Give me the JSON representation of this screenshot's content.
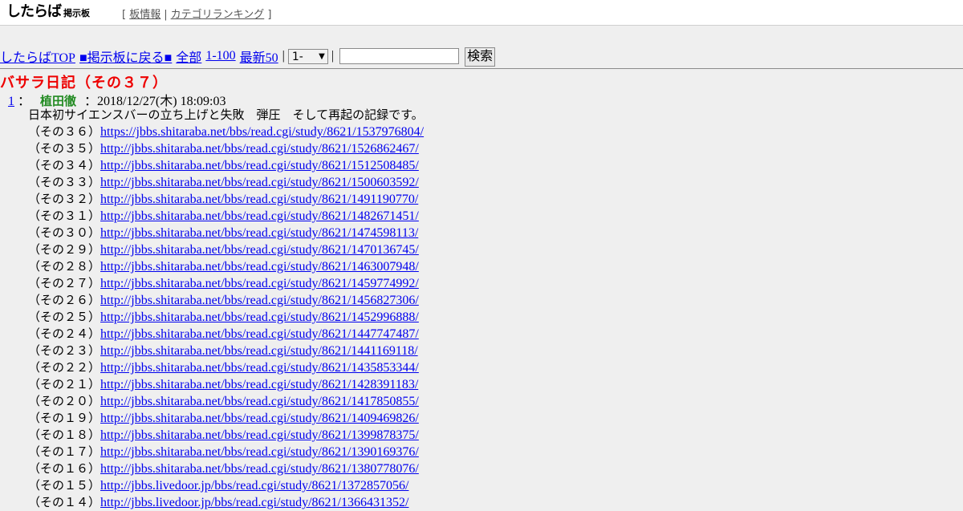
{
  "header": {
    "logo_main": "したらば",
    "logo_sub": "掲示板",
    "bracket_open": "[",
    "bracket_close": "]",
    "links": [
      "板情報",
      "カテゴリランキング"
    ]
  },
  "nav": {
    "links": [
      "したらばTOP",
      "■掲示板に戻る■",
      "全部",
      "1-100",
      "最新50"
    ],
    "separator": "|",
    "range_select": "1-",
    "search_button": "検索",
    "search_value": ""
  },
  "thread": {
    "title": "バサラ日記（その３７）",
    "post": {
      "number": "1",
      "colon": "：",
      "name": "植田徹",
      "date": "：2018/12/27(木) 18:09:03",
      "intro": "日本初サイエンスバーの立ち上げと失敗　弾圧　そして再起の記録です。",
      "entries": [
        {
          "label": "（その３６）",
          "url": "https://jbbs.shitaraba.net/bbs/read.cgi/study/8621/1537976804/"
        },
        {
          "label": "（その３５）",
          "url": "http://jbbs.shitaraba.net/bbs/read.cgi/study/8621/1526862467/"
        },
        {
          "label": "（その３４）",
          "url": "http://jbbs.shitaraba.net/bbs/read.cgi/study/8621/1512508485/"
        },
        {
          "label": "（その３３）",
          "url": "http://jbbs.shitaraba.net/bbs/read.cgi/study/8621/1500603592/"
        },
        {
          "label": "（その３２）",
          "url": "http://jbbs.shitaraba.net/bbs/read.cgi/study/8621/1491190770/"
        },
        {
          "label": "（その３１）",
          "url": "http://jbbs.shitaraba.net/bbs/read.cgi/study/8621/1482671451/"
        },
        {
          "label": "（その３０）",
          "url": "http://jbbs.shitaraba.net/bbs/read.cgi/study/8621/1474598113/"
        },
        {
          "label": "（その２９）",
          "url": "http://jbbs.shitaraba.net/bbs/read.cgi/study/8621/1470136745/"
        },
        {
          "label": "（その２８）",
          "url": "http://jbbs.shitaraba.net/bbs/read.cgi/study/8621/1463007948/"
        },
        {
          "label": "（その２７）",
          "url": "http://jbbs.shitaraba.net/bbs/read.cgi/study/8621/1459774992/"
        },
        {
          "label": "（その２６）",
          "url": "http://jbbs.shitaraba.net/bbs/read.cgi/study/8621/1456827306/"
        },
        {
          "label": "（その２５）",
          "url": "http://jbbs.shitaraba.net/bbs/read.cgi/study/8621/1452996888/"
        },
        {
          "label": "（その２４）",
          "url": "http://jbbs.shitaraba.net/bbs/read.cgi/study/8621/1447747487/"
        },
        {
          "label": "（その２３）",
          "url": "http://jbbs.shitaraba.net/bbs/read.cgi/study/8621/1441169118/"
        },
        {
          "label": "（その２２）",
          "url": "http://jbbs.shitaraba.net/bbs/read.cgi/study/8621/1435853344/"
        },
        {
          "label": "（その２１）",
          "url": "http://jbbs.shitaraba.net/bbs/read.cgi/study/8621/1428391183/"
        },
        {
          "label": "（その２０）",
          "url": "http://jbbs.shitaraba.net/bbs/read.cgi/study/8621/1417850855/"
        },
        {
          "label": "（その１９）",
          "url": "http://jbbs.shitaraba.net/bbs/read.cgi/study/8621/1409469826/"
        },
        {
          "label": "（その１８）",
          "url": "http://jbbs.shitaraba.net/bbs/read.cgi/study/8621/1399878375/"
        },
        {
          "label": "（その１７）",
          "url": "http://jbbs.shitaraba.net/bbs/read.cgi/study/8621/1390169376/"
        },
        {
          "label": "（その１６）",
          "url": "http://jbbs.shitaraba.net/bbs/read.cgi/study/8621/1380778076/"
        },
        {
          "label": "（その１５）",
          "url": "http://jbbs.livedoor.jp/bbs/read.cgi/study/8621/1372857056/"
        },
        {
          "label": "（その１４）",
          "url": "http://jbbs.livedoor.jp/bbs/read.cgi/study/8621/1366431352/"
        }
      ]
    }
  },
  "colors": {
    "link": "#0000ee",
    "title": "#ee0000",
    "name": "#228b22",
    "background": "#efefef"
  }
}
